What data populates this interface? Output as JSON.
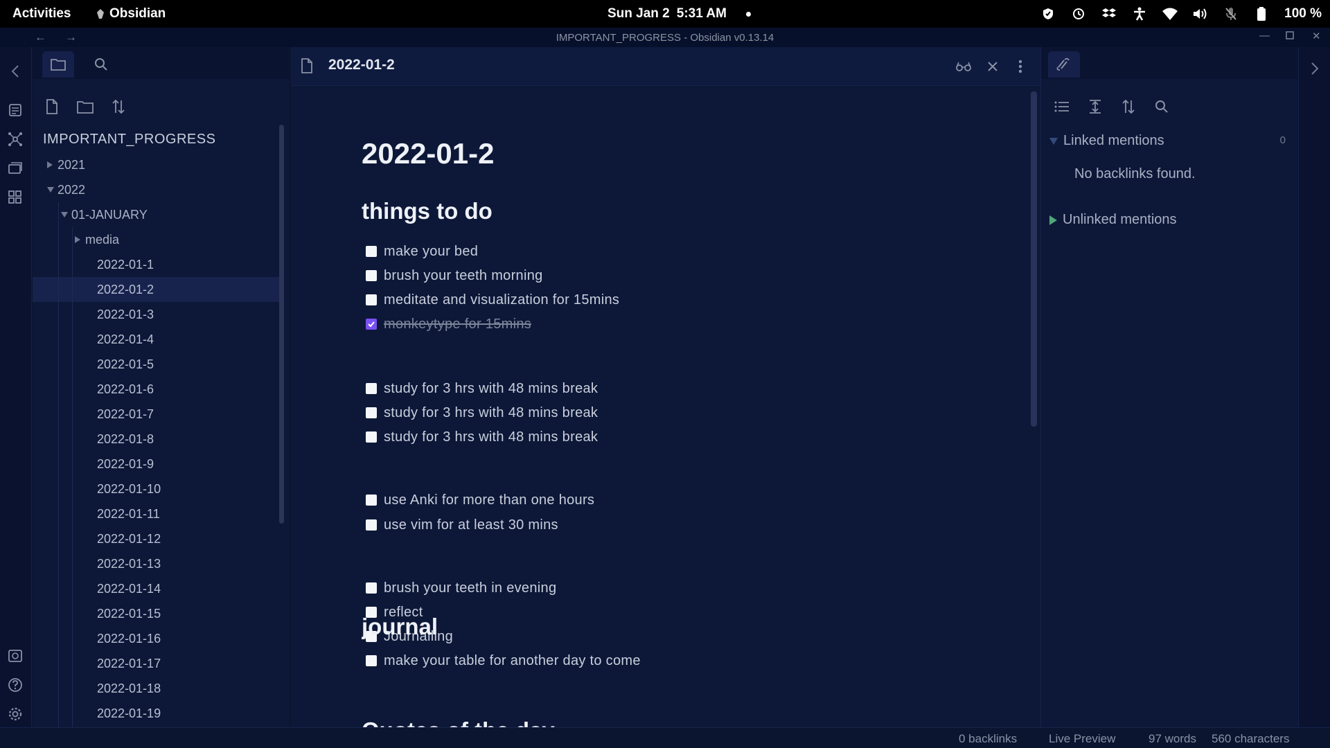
{
  "topbar": {
    "activities": "Activities",
    "app_name": "Obsidian",
    "date": "Sun Jan 2",
    "time": "5:31 AM",
    "battery": "100 %"
  },
  "titlebar": {
    "title": "IMPORTANT_PROGRESS - Obsidian v0.13.14"
  },
  "explorer": {
    "vault_name": "IMPORTANT_PROGRESS",
    "tree": [
      {
        "label": "2021",
        "type": "folder",
        "expanded": false,
        "depth": 0
      },
      {
        "label": "2022",
        "type": "folder",
        "expanded": true,
        "depth": 0
      },
      {
        "label": "01-JANUARY",
        "type": "folder",
        "expanded": true,
        "depth": 1
      },
      {
        "label": "media",
        "type": "folder",
        "expanded": false,
        "depth": 2
      },
      {
        "label": "2022-01-1",
        "type": "file",
        "depth": 2
      },
      {
        "label": "2022-01-2",
        "type": "file",
        "depth": 2,
        "selected": true
      },
      {
        "label": "2022-01-3",
        "type": "file",
        "depth": 2
      },
      {
        "label": "2022-01-4",
        "type": "file",
        "depth": 2
      },
      {
        "label": "2022-01-5",
        "type": "file",
        "depth": 2
      },
      {
        "label": "2022-01-6",
        "type": "file",
        "depth": 2
      },
      {
        "label": "2022-01-7",
        "type": "file",
        "depth": 2
      },
      {
        "label": "2022-01-8",
        "type": "file",
        "depth": 2
      },
      {
        "label": "2022-01-9",
        "type": "file",
        "depth": 2
      },
      {
        "label": "2022-01-10",
        "type": "file",
        "depth": 2
      },
      {
        "label": "2022-01-11",
        "type": "file",
        "depth": 2
      },
      {
        "label": "2022-01-12",
        "type": "file",
        "depth": 2
      },
      {
        "label": "2022-01-13",
        "type": "file",
        "depth": 2
      },
      {
        "label": "2022-01-14",
        "type": "file",
        "depth": 2
      },
      {
        "label": "2022-01-15",
        "type": "file",
        "depth": 2
      },
      {
        "label": "2022-01-16",
        "type": "file",
        "depth": 2
      },
      {
        "label": "2022-01-17",
        "type": "file",
        "depth": 2
      },
      {
        "label": "2022-01-18",
        "type": "file",
        "depth": 2
      },
      {
        "label": "2022-01-19",
        "type": "file",
        "depth": 2
      }
    ]
  },
  "editor": {
    "tab_title": "2022-01-2",
    "heading": "2022-01-2",
    "section_todo": "things to do",
    "tasks": [
      {
        "text": "make your bed",
        "done": false
      },
      {
        "text": "brush your teeth morning",
        "done": false
      },
      {
        "text": "meditate and visualization for 15mins",
        "done": false
      },
      {
        "text": "monkeytype for 15mins",
        "done": true
      },
      {
        "text": "study for 3 hrs with 48 mins break",
        "done": false
      },
      {
        "text": "study for 3 hrs with 48 mins break",
        "done": false
      },
      {
        "text": "study for 3 hrs with 48 mins break",
        "done": false
      },
      {
        "text": "use Anki for more than one hours",
        "done": false
      },
      {
        "text": "use vim for at least 30 mins",
        "done": false
      },
      {
        "text": "brush your teeth in evening",
        "done": false
      },
      {
        "text": "reflect",
        "done": false
      },
      {
        "text": "Journalling",
        "done": false
      },
      {
        "text": "make your table for another day to come",
        "done": false
      }
    ],
    "section_journal": "journal",
    "section_quotes": "Quotes of the day"
  },
  "backlinks": {
    "linked_label": "Linked mentions",
    "linked_count": "0",
    "no_backlinks": "No backlinks found.",
    "unlinked_label": "Unlinked mentions"
  },
  "status": {
    "backlinks": "0 backlinks",
    "mode": "Live Preview",
    "words": "97 words",
    "characters": "560 characters"
  },
  "colors": {
    "background": "#0d1838",
    "accent": "#7a50f2",
    "selected_row": "#17234d"
  }
}
